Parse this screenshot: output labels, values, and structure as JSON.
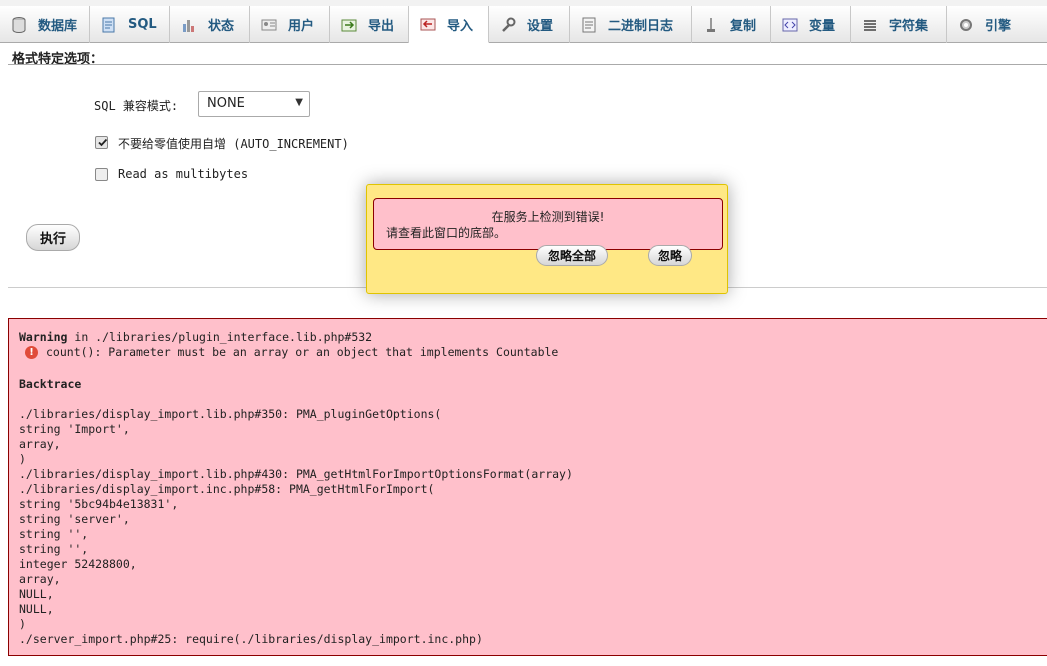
{
  "tabs": [
    {
      "label": "数据库",
      "icon": "database-icon"
    },
    {
      "label": "SQL",
      "icon": "sql-icon"
    },
    {
      "label": "状态",
      "icon": "status-icon"
    },
    {
      "label": "用户",
      "icon": "users-icon"
    },
    {
      "label": "导出",
      "icon": "export-icon"
    },
    {
      "label": "导入",
      "icon": "import-icon",
      "active": true
    },
    {
      "label": "设置",
      "icon": "settings-icon"
    },
    {
      "label": "二进制日志",
      "icon": "binlog-icon"
    },
    {
      "label": "复制",
      "icon": "replication-icon"
    },
    {
      "label": "变量",
      "icon": "variables-icon"
    },
    {
      "label": "字符集",
      "icon": "charset-icon"
    },
    {
      "label": "引擎",
      "icon": "engine-icon"
    }
  ],
  "format_options": {
    "title": "格式特定选项：",
    "sql_compat_label": "SQL 兼容模式:",
    "sql_compat_value": "NONE",
    "no_auto_value_label": "不要给零值使用自增 (AUTO_INCREMENT)",
    "no_auto_value_checked": true,
    "read_multibytes_label": "Read as multibytes",
    "read_multibytes_checked": false,
    "execute_label": "执行"
  },
  "popup": {
    "line1": "在服务上检测到错误!",
    "line2": "请查看此窗口的底部。",
    "ignore_all_label": "忽略全部",
    "ignore_label": "忽略"
  },
  "error": {
    "warning_word": "Warning",
    "warning_rest": " in ./libraries/plugin_interface.lib.php#532",
    "message": "count(): Parameter must be an array or an object that implements Countable",
    "backtrace_title": "Backtrace",
    "trace": [
      "./libraries/display_import.lib.php#350: PMA_pluginGetOptions(",
      "string 'Import',",
      "array,",
      ")",
      "./libraries/display_import.lib.php#430: PMA_getHtmlForImportOptionsFormat(array)",
      "./libraries/display_import.inc.php#58: PMA_getHtmlForImport(",
      "string '5bc94b4e13831',",
      "string 'server',",
      "string '',",
      "string '',",
      "integer 52428800,",
      "array,",
      "NULL,",
      "NULL,",
      ")",
      "./server_import.php#25: require(./libraries/display_import.inc.php)"
    ]
  }
}
